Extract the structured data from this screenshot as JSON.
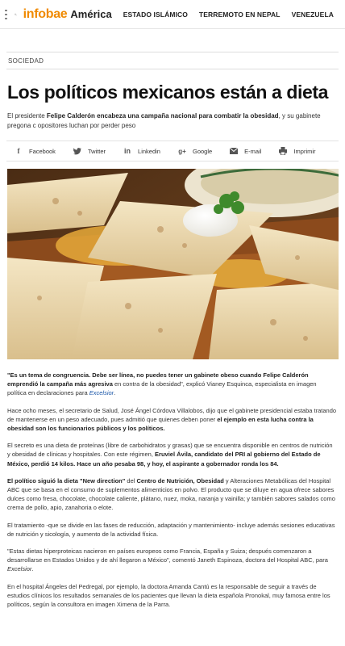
{
  "nav": {
    "brand": "infobae",
    "region": "América",
    "items": [
      "ESTADO ISLÁMICO",
      "TERREMOTO EN NEPAL",
      "VENEZUELA"
    ]
  },
  "section": "SOCIEDAD",
  "title": "Los políticos mexicanos están a dieta",
  "lead": {
    "p1": "El presidente ",
    "b1": "Felipe Calderón encabeza una campaña nacional para combatir la obesidad",
    "p2": ", y su gabinete pregona c opositores luchan por perder peso"
  },
  "share": {
    "facebook": "Facebook",
    "twitter": "Twitter",
    "linkedin": "Linkedin",
    "google": "Google",
    "email": "E-mail",
    "print": "Imprimir"
  },
  "article": {
    "p1_b": "\"Es un tema de congruencia. Debe ser línea, no puedes tener un gabinete obeso cuando Felipe Calderón emprendió la campaña más agresiva",
    "p1_t": " en contra de la obesidad\", explicó Vianey Esquinca, especialista en imagen política en declaraciones para ",
    "p1_link": "Excelsior",
    "p1_end": ".",
    "p2_t": "Hace ocho meses, el secretario de Salud, José Ángel Córdova Villalobos, dijo que el gabinete presidencial estaba tratando de mantenerse en un peso adecuado, pues admitió que quienes deben poner ",
    "p2_b": "el ejemplo en esta lucha contra la obesidad son los funcionarios públicos y los políticos.",
    "p3_t": "El secreto es una dieta de proteínas (libre de carbohidratos y grasas) que se encuentra disponible en centros de nutrición y obesidad de clínicas y hospitales. Con este régimen, ",
    "p3_b": "Eruviel Ávila, candidato del PRI al gobierno del Estado de México, perdió 14 kilos. Hace un año pesaba 98, y hoy, el aspirante a gobernador ronda los 84.",
    "p4_b1": "El político siguió la dieta \"New direction\"",
    "p4_t1": " del ",
    "p4_b2": "Centro de Nutrición, Obesidad",
    "p4_t2": " y Alteraciones Metabólicas del Hospital ABC que se basa en el consumo de suplementos alimenticios en polvo. El producto que se diluye en agua ofrece sabores dulces como fresa, chocolate, chocolate caliente, plátano, nuez, moka, naranja y vainilla; y también sabores salados como crema de pollo, apio, zanahoria o elote.",
    "p5": "El tratamiento -que se divide en las fases de reducción, adaptación y mantenimiento- incluye además sesiones educativas de nutrición y sicología, y aumento de la actividad física.",
    "p6_t": "\"Estas dietas hiperproteicas nacieron en países europeos como Francia, España y Suiza; después comenzaron a desarrollarse en Estados Unidos y de ahí llegaron a México\", comentó Janeth Espinoza, doctora del Hospital ABC, para ",
    "p6_i": "Excelsior",
    "p6_end": ".",
    "p7": "En el hospital Ángeles del Pedregal, por ejemplo, la doctora Amanda Cantú es la responsable de seguir a través de estudios clínicos los resultados semanales de los pacientes que llevan la dieta española Pronokal, muy famosa entre los políticos, según la consultora en imagen Ximena de la Parra."
  },
  "colors": {
    "brand": "#f08a00",
    "link": "#1a56a8"
  }
}
